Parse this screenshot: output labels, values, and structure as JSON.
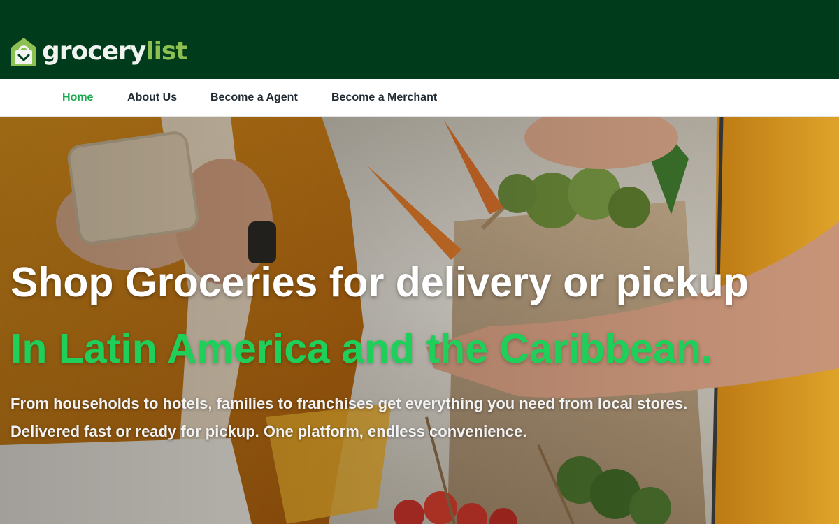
{
  "brand": {
    "name_part1": "grocery",
    "name_part2": "list",
    "icon": "shopping-bag-house-icon"
  },
  "nav": {
    "items": [
      {
        "label": "Home",
        "active": true
      },
      {
        "label": "About Us",
        "active": false
      },
      {
        "label": "Become a Agent",
        "active": false
      },
      {
        "label": "Become a Merchant",
        "active": false
      }
    ]
  },
  "hero": {
    "title": "Shop Groceries for delivery or pickup",
    "subtitle": "In Latin America and the Caribbean.",
    "description_line1": "From households to hotels, families to franchises get everything you need from local stores.",
    "description_line2": "Delivered fast or ready for pickup. One platform, endless convenience."
  },
  "colors": {
    "header_bg": "#003b1c",
    "nav_active": "#17a94b",
    "nav_text": "#1f2a33",
    "hero_accent": "#1ed05a",
    "logo_accent": "#8cc152"
  }
}
